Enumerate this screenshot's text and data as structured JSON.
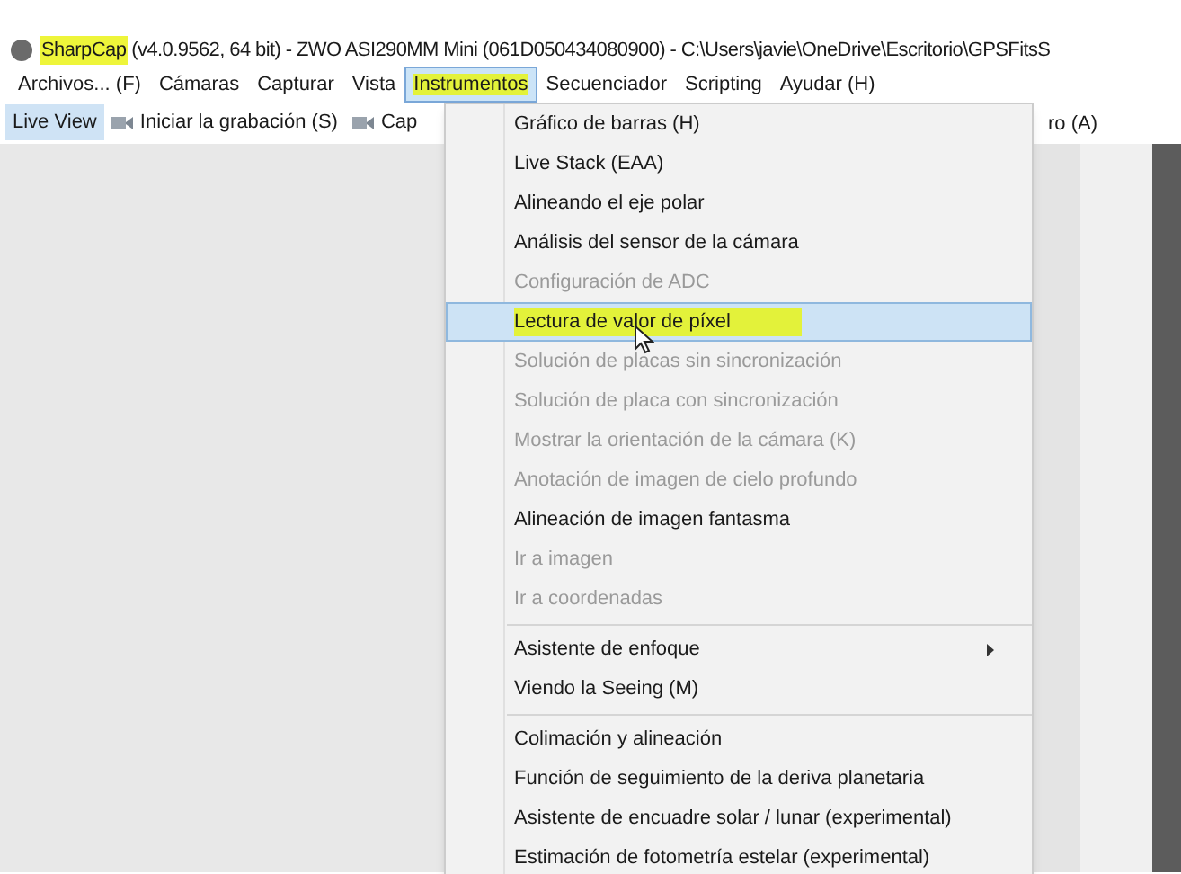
{
  "window": {
    "app_name": "SharpCap",
    "app_name_highlighted": true,
    "title_rest": "(v4.0.9562, 64 bit) - ZWO ASI290MM Mini (061D050434080900) - C:\\Users\\javie\\OneDrive\\Escritorio\\GPSFitsS"
  },
  "menu_bar": [
    {
      "label": "Archivos... (F)",
      "selected": false,
      "highlighted": false
    },
    {
      "label": "Cámaras",
      "selected": false,
      "highlighted": false
    },
    {
      "label": "Capturar",
      "selected": false,
      "highlighted": false
    },
    {
      "label": "Vista",
      "selected": false,
      "highlighted": false
    },
    {
      "label": "Instrumentos",
      "selected": true,
      "highlighted": true
    },
    {
      "label": "Secuenciador",
      "selected": false,
      "highlighted": false
    },
    {
      "label": "Scripting",
      "selected": false,
      "highlighted": false
    },
    {
      "label": "Ayudar (H)",
      "selected": false,
      "highlighted": false
    }
  ],
  "toolbar": [
    {
      "label": "Live View",
      "selected": true,
      "icon": false
    },
    {
      "label": "Iniciar la grabación (S)",
      "selected": false,
      "icon": true
    },
    {
      "label": "Cap",
      "selected": false,
      "icon": true
    }
  ],
  "toolbar_right": "ro (A)",
  "dropdown": [
    {
      "kind": "item",
      "label": "Gráfico de barras (H)",
      "disabled": false,
      "selected": false,
      "highlighted": false
    },
    {
      "kind": "item",
      "label": "Live Stack (EAA)",
      "disabled": false,
      "selected": false,
      "highlighted": false
    },
    {
      "kind": "item",
      "label": "Alineando el eje polar",
      "disabled": false,
      "selected": false,
      "highlighted": false
    },
    {
      "kind": "item",
      "label": "Análisis del sensor de la cámara",
      "disabled": false,
      "selected": false,
      "highlighted": false
    },
    {
      "kind": "item",
      "label": "Configuración de ADC",
      "disabled": true,
      "selected": false,
      "highlighted": false
    },
    {
      "kind": "item",
      "label": "Lectura de valor de píxel",
      "disabled": false,
      "selected": true,
      "highlighted": true
    },
    {
      "kind": "item",
      "label": "Solución de placas sin sincronización",
      "disabled": true,
      "selected": false,
      "highlighted": false
    },
    {
      "kind": "item",
      "label": "Solución de placa con sincronización",
      "disabled": true,
      "selected": false,
      "highlighted": false
    },
    {
      "kind": "item",
      "label": "Mostrar la orientación de la cámara (K)",
      "disabled": true,
      "selected": false,
      "highlighted": false
    },
    {
      "kind": "item",
      "label": "Anotación de imagen de cielo profundo",
      "disabled": true,
      "selected": false,
      "highlighted": false
    },
    {
      "kind": "item",
      "label": "Alineación de imagen fantasma",
      "disabled": false,
      "selected": false,
      "highlighted": false
    },
    {
      "kind": "item",
      "label": "Ir a imagen",
      "disabled": true,
      "selected": false,
      "highlighted": false
    },
    {
      "kind": "item",
      "label": "Ir a coordenadas",
      "disabled": true,
      "selected": false,
      "highlighted": false
    },
    {
      "kind": "separator"
    },
    {
      "kind": "submenu",
      "label": "Asistente de enfoque",
      "disabled": false,
      "selected": false,
      "highlighted": false
    },
    {
      "kind": "item",
      "label": "Viendo la Seeing (M)",
      "disabled": false,
      "selected": false,
      "highlighted": false
    },
    {
      "kind": "separator"
    },
    {
      "kind": "item",
      "label": "Colimación y alineación",
      "disabled": false,
      "selected": false,
      "highlighted": false
    },
    {
      "kind": "item",
      "label": "Función de seguimiento de la deriva planetaria",
      "disabled": false,
      "selected": false,
      "highlighted": false
    },
    {
      "kind": "item",
      "label": "Asistente de encuadre solar / lunar (experimental)",
      "disabled": false,
      "selected": false,
      "highlighted": false
    },
    {
      "kind": "item",
      "label": "Estimación de fotometría estelar (experimental)",
      "disabled": false,
      "selected": false,
      "highlighted": false
    }
  ]
}
